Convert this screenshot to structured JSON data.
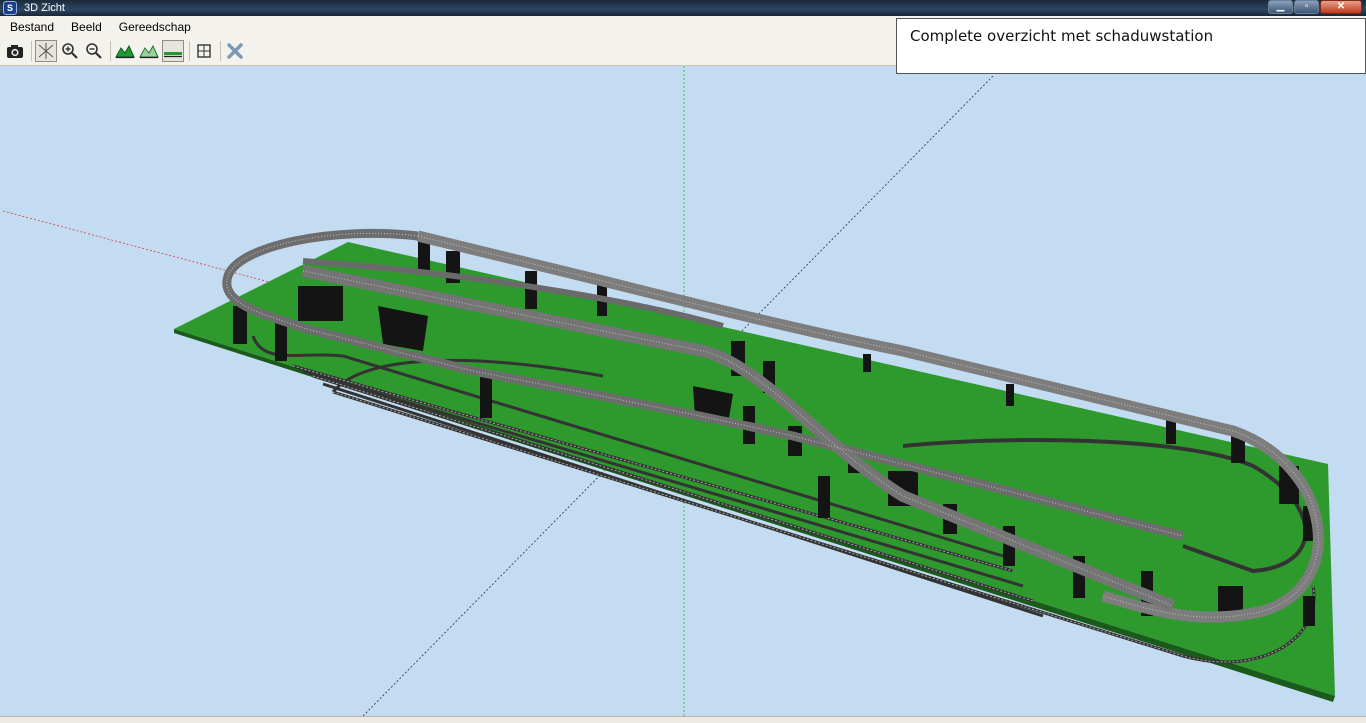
{
  "window": {
    "title": "3D Zicht",
    "icon": "app-icon",
    "buttons": [
      "minimize-icon",
      "maximize-icon",
      "close-icon"
    ]
  },
  "menu": {
    "items": [
      "Bestand",
      "Beeld",
      "Gereedschap"
    ]
  },
  "toolbar": {
    "buttons": [
      {
        "name": "camera-icon",
        "pressed": false
      },
      {
        "name": "rotate-axes-icon",
        "pressed": true
      },
      {
        "name": "zoom-in-icon",
        "pressed": false
      },
      {
        "name": "zoom-out-icon",
        "pressed": false
      },
      {
        "name": "landscape-view-icon",
        "pressed": false
      },
      {
        "name": "landscape-outline-icon",
        "pressed": false
      },
      {
        "name": "flat-view-icon",
        "pressed": true
      },
      {
        "name": "fit-view-icon",
        "pressed": false
      },
      {
        "name": "close-view-icon",
        "pressed": false
      }
    ]
  },
  "annotation": {
    "text": "Complete overzicht met schaduwstation"
  },
  "scene": {
    "background_color": "#c4dcf2",
    "baseboard_color": "#2e9a2e",
    "track_color": "#8c8c8c",
    "pillar_color": "#141414",
    "axis_colors": {
      "x": "#d04040",
      "y": "#30b030",
      "z": "#303030"
    }
  }
}
